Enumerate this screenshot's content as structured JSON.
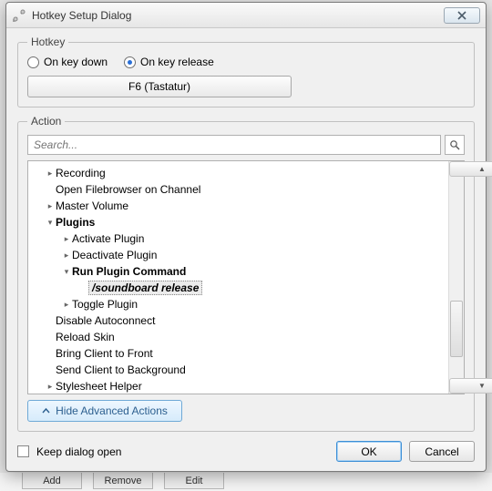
{
  "title": "Hotkey Setup Dialog",
  "hotkey": {
    "legend": "Hotkey",
    "radio_down": "On key down",
    "radio_release": "On key release",
    "selected": "release",
    "binding": "F6 (Tastatur)"
  },
  "action": {
    "legend": "Action",
    "search_placeholder": "Search...",
    "tree": [
      {
        "indent": 1,
        "arrow": "right",
        "label": "Recording"
      },
      {
        "indent": 1,
        "arrow": "none",
        "label": "Open Filebrowser on Channel"
      },
      {
        "indent": 1,
        "arrow": "right",
        "label": "Master Volume"
      },
      {
        "indent": 1,
        "arrow": "down",
        "label": "Plugins",
        "bold": true
      },
      {
        "indent": 2,
        "arrow": "right",
        "label": "Activate Plugin"
      },
      {
        "indent": 2,
        "arrow": "right",
        "label": "Deactivate Plugin"
      },
      {
        "indent": 2,
        "arrow": "down",
        "label": "Run Plugin Command",
        "bold": true
      },
      {
        "indent": 3,
        "arrow": "none",
        "label": "/soundboard release",
        "bold": true,
        "ital": true,
        "selected": true
      },
      {
        "indent": 2,
        "arrow": "right",
        "label": "Toggle Plugin"
      },
      {
        "indent": 1,
        "arrow": "none",
        "label": "Disable Autoconnect"
      },
      {
        "indent": 1,
        "arrow": "none",
        "label": "Reload Skin"
      },
      {
        "indent": 1,
        "arrow": "none",
        "label": "Bring Client to Front"
      },
      {
        "indent": 1,
        "arrow": "none",
        "label": "Send Client to Background"
      },
      {
        "indent": 1,
        "arrow": "right",
        "label": "Stylesheet Helper"
      }
    ],
    "toggle": "Hide Advanced Actions"
  },
  "footer": {
    "keep_open": "Keep dialog open",
    "ok": "OK",
    "cancel": "Cancel"
  },
  "background": {
    "add": "Add",
    "remove": "Remove",
    "edit": "Edit"
  }
}
